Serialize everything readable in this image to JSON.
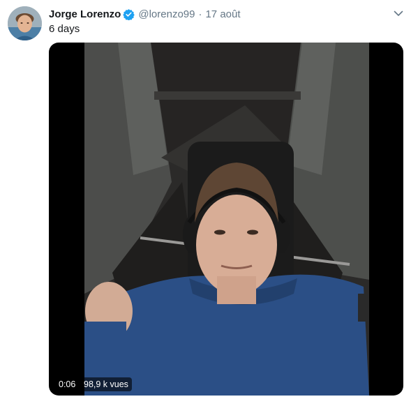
{
  "tweet": {
    "author_name": "Jorge Lorenzo",
    "handle": "@lorenzo99",
    "separator": "·",
    "date": "17 août",
    "text": "6 days",
    "icons": {
      "verified": "verified-badge-icon",
      "menu": "chevron-down-icon"
    },
    "video": {
      "duration": "0:06",
      "views": "98,9 k vues"
    }
  },
  "colors": {
    "primary_text": "#14171a",
    "secondary_text": "#657786",
    "verified_blue": "#1da1f2",
    "video_letterbox": "#000000"
  }
}
